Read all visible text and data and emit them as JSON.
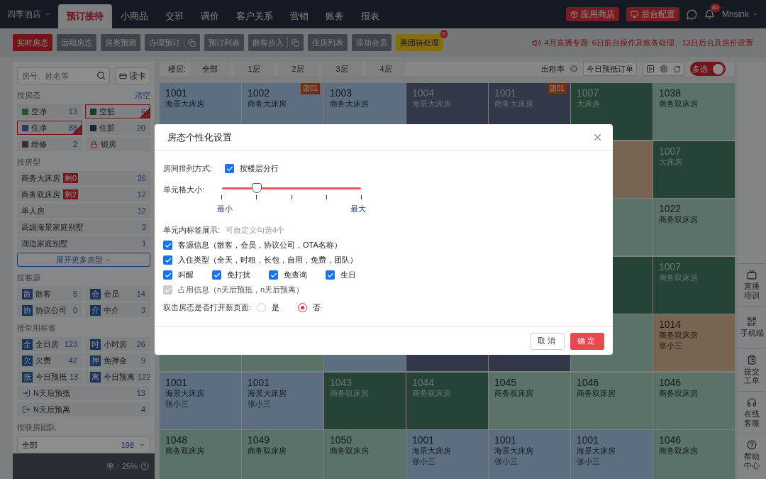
{
  "top_nav": {
    "hotel": "四季酒店",
    "tabs": [
      {
        "label": "预订接待",
        "selected": true
      },
      {
        "label": "小商品",
        "selected": false
      },
      {
        "label": "交班",
        "selected": false
      },
      {
        "label": "调价",
        "selected": false
      },
      {
        "label": "客户关系",
        "selected": false
      },
      {
        "label": "营销",
        "selected": false
      },
      {
        "label": "账务",
        "selected": false
      },
      {
        "label": "报表",
        "selected": false
      }
    ],
    "app_store": "应用商店",
    "backend": "后台配置",
    "notifications": "86",
    "user": "Mnsink"
  },
  "sub_nav": {
    "buttons": [
      {
        "label": "实时房态",
        "kind": "plain",
        "selected": true
      },
      {
        "label": "远期房态",
        "kind": "plain",
        "selected": false
      },
      {
        "label": "房类预测",
        "kind": "plain",
        "selected": false
      },
      {
        "label": "办理预订",
        "kind": "copy",
        "selected": false
      },
      {
        "label": "预订列表",
        "kind": "plain",
        "selected": false
      },
      {
        "label": "散客步入",
        "kind": "copy",
        "selected": false
      },
      {
        "label": "住店列表",
        "kind": "plain",
        "selected": false
      },
      {
        "label": "添加会员",
        "kind": "plain",
        "selected": false
      },
      {
        "label": "美团待处理",
        "kind": "highlight",
        "badge": "6"
      }
    ],
    "notice": "4月直播专题: 6日前台操作及账务处理、13日后台及房价设置"
  },
  "sidebar": {
    "search": {
      "placeholder": "房号、姓名等"
    },
    "card_button": "读卡",
    "status": {
      "title": "按房态",
      "clear": "清空",
      "items": [
        {
          "kind": "vacant_clean",
          "label": "空净",
          "count": "13",
          "selected": false
        },
        {
          "kind": "vacant_dirty",
          "label": "空脏",
          "count": "6",
          "selected": true
        },
        {
          "kind": "occupied_clean",
          "label": "住净",
          "count": "88",
          "selected": true
        },
        {
          "kind": "occupied_dirty",
          "label": "住脏",
          "count": "20",
          "selected": false
        },
        {
          "kind": "maintenance",
          "label": "维修",
          "count": "2",
          "selected": false
        },
        {
          "kind": "lock",
          "label": "锁房",
          "selected": false
        }
      ]
    },
    "room_types": {
      "title": "按房型",
      "items": [
        {
          "label": "商务大床房",
          "badge": "剩0",
          "count": "26"
        },
        {
          "label": "商务双床房",
          "badge": "剩2",
          "count": "12"
        },
        {
          "label": "单人房",
          "count": "12"
        },
        {
          "label": "高级海景家庭别墅",
          "count": "3"
        },
        {
          "label": "湖边家庭别墅",
          "count": "1"
        }
      ],
      "expand": "展开更多房型"
    },
    "sources": {
      "title": "按客源",
      "items": [
        {
          "icon": "散",
          "label": "散客",
          "count": "5"
        },
        {
          "icon": "会",
          "label": "会员",
          "count": "14"
        },
        {
          "icon": "协",
          "label": "协议公司",
          "count": "0"
        },
        {
          "icon": "介",
          "label": "中介",
          "count": "3"
        }
      ]
    },
    "tags": {
      "title": "按常用标签",
      "items": [
        {
          "kind": "glyph",
          "icon": "全",
          "label": "全日房",
          "count": "123"
        },
        {
          "kind": "glyph",
          "icon": "时",
          "label": "小时房",
          "count": "26"
        },
        {
          "kind": "glyph",
          "icon": "欠",
          "label": "欠费",
          "count": "42"
        },
        {
          "kind": "glyph",
          "icon": "押",
          "label": "免押金",
          "count": "9"
        },
        {
          "kind": "glyph",
          "icon": "抵",
          "label": "今日预抵",
          "count": "13"
        },
        {
          "kind": "glyph",
          "icon": "离",
          "label": "今日预离",
          "count": "122"
        },
        {
          "kind": "arrive",
          "label": "N天后预抵",
          "count": "13"
        },
        {
          "kind": "leave",
          "label": "N天后预离",
          "count": "4"
        }
      ]
    },
    "team": {
      "title": "按联房团队",
      "value": "全部",
      "count": "198"
    },
    "footer": "率：25%"
  },
  "floor_bar": {
    "label": "楼层:",
    "floors": [
      "全部",
      "1层",
      "2层",
      "3层",
      "4层"
    ],
    "occupancy": "出租率",
    "arrivals": "今日预抵订单",
    "multi": {
      "label": "多选",
      "on": true
    }
  },
  "rooms": [
    [
      {
        "number": "1001",
        "type": "海景大床房",
        "kind": "occupied_clean"
      },
      {
        "number": "1002",
        "type": "商务大床房",
        "kind": "occupied_clean",
        "tag": "团01"
      },
      {
        "number": "1003",
        "type": "商务大床房",
        "kind": "occupied_clean"
      },
      {
        "number": "1004",
        "type": "海景大床房",
        "kind": "occupied_dirty"
      },
      {
        "number": "1001",
        "type": "商务大床房",
        "kind": "occupied_dirty",
        "tag": "团01"
      },
      {
        "number": "1007",
        "type": "大床房",
        "kind": "vacant_dirty"
      },
      {
        "number": "1038",
        "type": "商务双床房",
        "kind": "vacant_clean"
      }
    ],
    [
      {
        "kind": "covered"
      },
      {
        "kind": "covered"
      },
      {
        "kind": "covered"
      },
      {
        "kind": "covered"
      },
      {
        "kind": "covered"
      },
      {
        "kind": "maintenance"
      },
      {
        "number": "1007",
        "type": "大床房",
        "kind": "vacant_dirty"
      }
    ],
    [
      {
        "kind": "covered"
      },
      {
        "kind": "covered"
      },
      {
        "kind": "covered"
      },
      {
        "kind": "covered"
      },
      {
        "kind": "covered"
      },
      {
        "kind": "vacant_clean"
      },
      {
        "number": "1022",
        "type": "商务双床房",
        "kind": "vacant_clean"
      }
    ],
    [
      {
        "kind": "covered"
      },
      {
        "kind": "covered"
      },
      {
        "kind": "covered"
      },
      {
        "kind": "covered"
      },
      {
        "kind": "covered"
      },
      {
        "kind": "vacant_dirty"
      },
      {
        "number": "1007",
        "type": "商务双床房",
        "kind": "vacant_dirty"
      }
    ],
    [
      {
        "kind": "vacant_clean"
      },
      {
        "kind": "vacant_clean"
      },
      {
        "kind": "occupied_clean"
      },
      {
        "kind": "occupied_dirty"
      },
      {
        "kind": "occupied_dirty"
      },
      {
        "kind": "vacant_clean"
      },
      {
        "number": "1014",
        "type": "商务双床房",
        "guest": "张小三",
        "kind": "maintenance"
      }
    ],
    [
      {
        "number": "1001",
        "type": "海景大床房",
        "guest": "张小三",
        "kind": "occupied_clean"
      },
      {
        "number": "1001",
        "type": "海景大床房",
        "guest": "张小三",
        "kind": "occupied_clean"
      },
      {
        "number": "1043",
        "type": "商务双床房",
        "kind": "vacant_dirty"
      },
      {
        "number": "1044",
        "type": "商务双床房",
        "kind": "vacant_dirty"
      },
      {
        "number": "1045",
        "type": "商务双床房",
        "kind": "vacant_clean"
      },
      {
        "number": "1046",
        "type": "商务双床房",
        "kind": "vacant_clean"
      },
      {
        "number": "1046",
        "type": "商务双床房",
        "kind": "vacant_clean"
      }
    ],
    [
      {
        "number": "1048",
        "type": "商务双床房",
        "kind": "vacant_clean"
      },
      {
        "number": "1049",
        "type": "商务双床房",
        "kind": "vacant_clean"
      },
      {
        "number": "1050",
        "type": "商务双床房",
        "kind": "vacant_clean"
      },
      {
        "number": "1001",
        "type": "海景大床房",
        "guest": "张小三",
        "kind": "occupied_clean"
      },
      {
        "number": "1001",
        "type": "海景大床房",
        "guest": "张小三",
        "kind": "occupied_clean"
      },
      {
        "number": "1001",
        "type": "海景大床房",
        "guest": "张小三",
        "kind": "occupied_clean"
      },
      {
        "number": "1046",
        "type": "商务双床房",
        "kind": "vacant_clean"
      }
    ]
  ],
  "right_rail": [
    {
      "kind": "live",
      "label": "直播培训"
    },
    {
      "kind": "mobile",
      "label": "手机端"
    },
    {
      "kind": "ticket",
      "label": "提交工单"
    },
    {
      "kind": "service",
      "label": "在线客服"
    },
    {
      "kind": "help",
      "label": "帮助中心"
    }
  ],
  "modal": {
    "title": "房态个性化设置",
    "arrangement": {
      "label": "房间排列方式:",
      "option": "按楼层分行",
      "checked": true
    },
    "cell_size": {
      "label": "单元格大小:",
      "level": 0.25,
      "min": "最小",
      "max": "最大"
    },
    "tags": {
      "label": "单元内标签展示:",
      "hint": "可自定义勾选4个",
      "rows": [
        [
          {
            "label": "客源信息（散客，会员，协议公司，OTA名称）",
            "checked": true,
            "disabled": false
          }
        ],
        [
          {
            "label": "入住类型（全天，时租，长包，自用，免费，团队）",
            "checked": true,
            "disabled": false
          }
        ],
        [
          {
            "label": "叫醒",
            "checked": true,
            "disabled": false
          },
          {
            "label": "免打扰",
            "checked": true,
            "disabled": false
          },
          {
            "label": "免查询",
            "checked": true,
            "disabled": false
          },
          {
            "label": "生日",
            "checked": true,
            "disabled": false
          }
        ],
        [
          {
            "label": "占用信息（n天后预抵，n天后预离）",
            "checked": true,
            "disabled": true
          }
        ]
      ]
    },
    "double_click": {
      "label": "双击房态是否打开新页面:",
      "options": [
        {
          "label": "是",
          "selected": false
        },
        {
          "label": "否",
          "selected": true
        }
      ]
    },
    "cancel": "取消",
    "ok": "确定"
  }
}
